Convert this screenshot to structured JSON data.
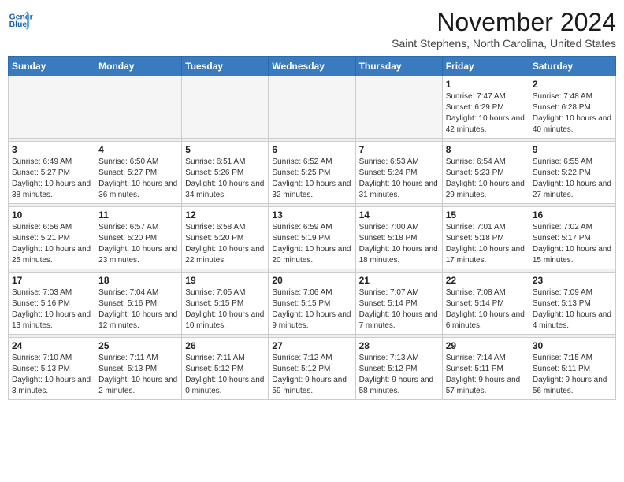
{
  "header": {
    "logo_line1": "General",
    "logo_line2": "Blue",
    "month": "November 2024",
    "location": "Saint Stephens, North Carolina, United States"
  },
  "weekdays": [
    "Sunday",
    "Monday",
    "Tuesday",
    "Wednesday",
    "Thursday",
    "Friday",
    "Saturday"
  ],
  "weeks": [
    [
      {
        "day": "",
        "info": ""
      },
      {
        "day": "",
        "info": ""
      },
      {
        "day": "",
        "info": ""
      },
      {
        "day": "",
        "info": ""
      },
      {
        "day": "",
        "info": ""
      },
      {
        "day": "1",
        "info": "Sunrise: 7:47 AM\nSunset: 6:29 PM\nDaylight: 10 hours and 42 minutes."
      },
      {
        "day": "2",
        "info": "Sunrise: 7:48 AM\nSunset: 6:28 PM\nDaylight: 10 hours and 40 minutes."
      }
    ],
    [
      {
        "day": "3",
        "info": "Sunrise: 6:49 AM\nSunset: 5:27 PM\nDaylight: 10 hours and 38 minutes."
      },
      {
        "day": "4",
        "info": "Sunrise: 6:50 AM\nSunset: 5:27 PM\nDaylight: 10 hours and 36 minutes."
      },
      {
        "day": "5",
        "info": "Sunrise: 6:51 AM\nSunset: 5:26 PM\nDaylight: 10 hours and 34 minutes."
      },
      {
        "day": "6",
        "info": "Sunrise: 6:52 AM\nSunset: 5:25 PM\nDaylight: 10 hours and 32 minutes."
      },
      {
        "day": "7",
        "info": "Sunrise: 6:53 AM\nSunset: 5:24 PM\nDaylight: 10 hours and 31 minutes."
      },
      {
        "day": "8",
        "info": "Sunrise: 6:54 AM\nSunset: 5:23 PM\nDaylight: 10 hours and 29 minutes."
      },
      {
        "day": "9",
        "info": "Sunrise: 6:55 AM\nSunset: 5:22 PM\nDaylight: 10 hours and 27 minutes."
      }
    ],
    [
      {
        "day": "10",
        "info": "Sunrise: 6:56 AM\nSunset: 5:21 PM\nDaylight: 10 hours and 25 minutes."
      },
      {
        "day": "11",
        "info": "Sunrise: 6:57 AM\nSunset: 5:20 PM\nDaylight: 10 hours and 23 minutes."
      },
      {
        "day": "12",
        "info": "Sunrise: 6:58 AM\nSunset: 5:20 PM\nDaylight: 10 hours and 22 minutes."
      },
      {
        "day": "13",
        "info": "Sunrise: 6:59 AM\nSunset: 5:19 PM\nDaylight: 10 hours and 20 minutes."
      },
      {
        "day": "14",
        "info": "Sunrise: 7:00 AM\nSunset: 5:18 PM\nDaylight: 10 hours and 18 minutes."
      },
      {
        "day": "15",
        "info": "Sunrise: 7:01 AM\nSunset: 5:18 PM\nDaylight: 10 hours and 17 minutes."
      },
      {
        "day": "16",
        "info": "Sunrise: 7:02 AM\nSunset: 5:17 PM\nDaylight: 10 hours and 15 minutes."
      }
    ],
    [
      {
        "day": "17",
        "info": "Sunrise: 7:03 AM\nSunset: 5:16 PM\nDaylight: 10 hours and 13 minutes."
      },
      {
        "day": "18",
        "info": "Sunrise: 7:04 AM\nSunset: 5:16 PM\nDaylight: 10 hours and 12 minutes."
      },
      {
        "day": "19",
        "info": "Sunrise: 7:05 AM\nSunset: 5:15 PM\nDaylight: 10 hours and 10 minutes."
      },
      {
        "day": "20",
        "info": "Sunrise: 7:06 AM\nSunset: 5:15 PM\nDaylight: 10 hours and 9 minutes."
      },
      {
        "day": "21",
        "info": "Sunrise: 7:07 AM\nSunset: 5:14 PM\nDaylight: 10 hours and 7 minutes."
      },
      {
        "day": "22",
        "info": "Sunrise: 7:08 AM\nSunset: 5:14 PM\nDaylight: 10 hours and 6 minutes."
      },
      {
        "day": "23",
        "info": "Sunrise: 7:09 AM\nSunset: 5:13 PM\nDaylight: 10 hours and 4 minutes."
      }
    ],
    [
      {
        "day": "24",
        "info": "Sunrise: 7:10 AM\nSunset: 5:13 PM\nDaylight: 10 hours and 3 minutes."
      },
      {
        "day": "25",
        "info": "Sunrise: 7:11 AM\nSunset: 5:13 PM\nDaylight: 10 hours and 2 minutes."
      },
      {
        "day": "26",
        "info": "Sunrise: 7:11 AM\nSunset: 5:12 PM\nDaylight: 10 hours and 0 minutes."
      },
      {
        "day": "27",
        "info": "Sunrise: 7:12 AM\nSunset: 5:12 PM\nDaylight: 9 hours and 59 minutes."
      },
      {
        "day": "28",
        "info": "Sunrise: 7:13 AM\nSunset: 5:12 PM\nDaylight: 9 hours and 58 minutes."
      },
      {
        "day": "29",
        "info": "Sunrise: 7:14 AM\nSunset: 5:11 PM\nDaylight: 9 hours and 57 minutes."
      },
      {
        "day": "30",
        "info": "Sunrise: 7:15 AM\nSunset: 5:11 PM\nDaylight: 9 hours and 56 minutes."
      }
    ]
  ]
}
